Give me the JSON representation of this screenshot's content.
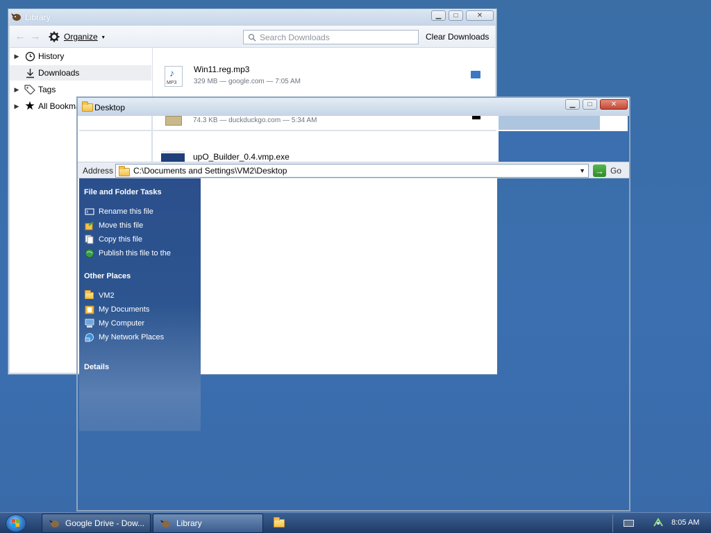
{
  "library": {
    "title": "Library",
    "organize_label": "Organize",
    "search_placeholder": "Search Downloads",
    "clear_label": "Clear Downloads",
    "sidebar": [
      {
        "label": "History"
      },
      {
        "label": "Downloads"
      },
      {
        "label": "Tags"
      },
      {
        "label": "All Bookma"
      }
    ],
    "downloads": [
      {
        "name": "Win11.reg.mp3",
        "meta": "329 MB — google.com — 7:05 AM",
        "icon": "mp3-file-icon",
        "badge": "MP3"
      },
      {
        "name": "",
        "meta": "74.3 KB — duckduckgo.com — 5:34 AM",
        "icon": "image-file-icon"
      },
      {
        "name": "upO_Builder_0.4.vmp.exe",
        "meta": "",
        "icon": "exe-file-icon"
      }
    ]
  },
  "desktop": {
    "title": "Desktop",
    "address_label": "Address",
    "address_value": "C:\\Documents and Settings\\VM2\\Desktop",
    "go_label": "Go",
    "tasks_header": "File and Folder Tasks",
    "tasks": [
      {
        "label": "Rename this file",
        "icon": "rename-icon"
      },
      {
        "label": "Move this file",
        "icon": "move-icon"
      },
      {
        "label": "Copy this file",
        "icon": "copy-icon"
      },
      {
        "label": "Publish this file to the",
        "icon": "publish-web-icon"
      }
    ],
    "places_header": "Other Places",
    "places": [
      {
        "label": "VM2",
        "icon": "folder-icon"
      },
      {
        "label": "My Documents",
        "icon": "my-documents-icon"
      },
      {
        "label": "My Computer",
        "icon": "my-computer-icon"
      },
      {
        "label": "My Network Places",
        "icon": "network-places-icon"
      }
    ],
    "details_header": "Details"
  },
  "taskbar": {
    "buttons": [
      {
        "label": "Google Drive - Dow...",
        "icon": "firefox-icon"
      },
      {
        "label": "Library",
        "icon": "firefox-icon"
      }
    ],
    "clock": "8:05 AM"
  },
  "colors": {
    "desktop_bg": "#3a6ea5",
    "task_pane": "#2d558f",
    "taskbar": "#1f3b66"
  }
}
